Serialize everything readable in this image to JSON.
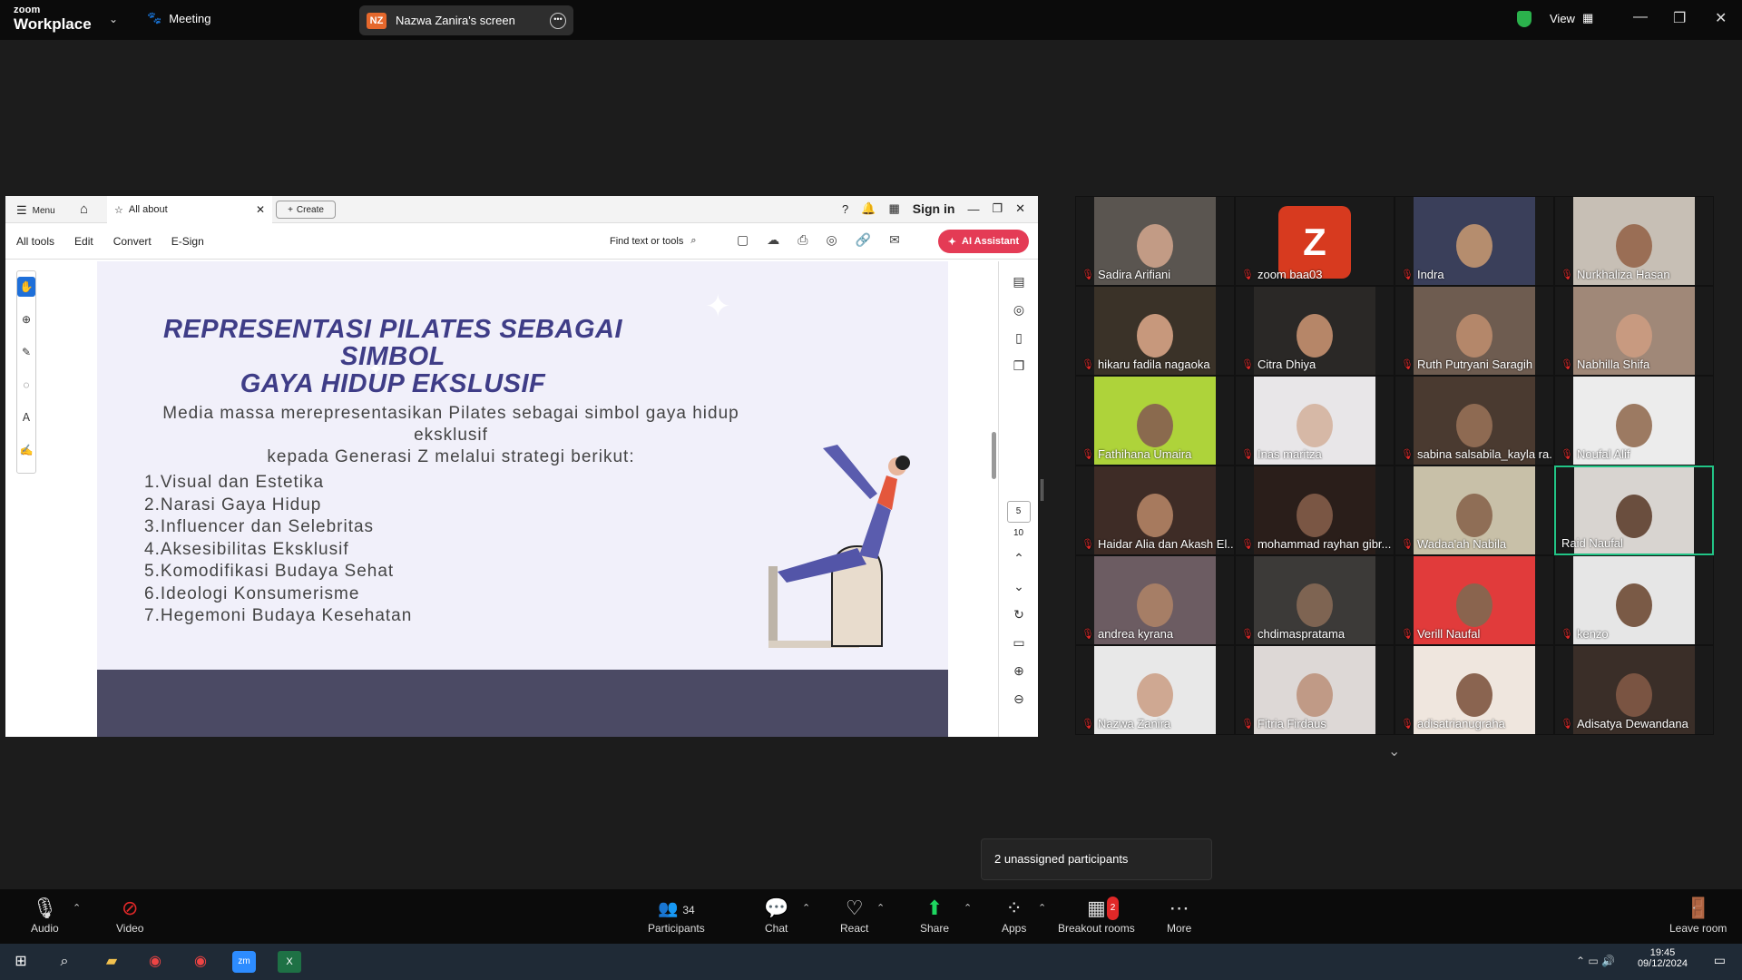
{
  "titlebar": {
    "logo_top": "zoom",
    "logo_bottom": "Workplace",
    "meeting_label": "Meeting",
    "share_initials": "NZ",
    "share_label": "Nazwa Zanira's screen",
    "view_label": "View"
  },
  "pdf": {
    "menu_label": "Menu",
    "tab_label": "All about",
    "create_label": "Create",
    "signin_label": "Sign in",
    "tools": [
      "All tools",
      "Edit",
      "Convert",
      "E-Sign"
    ],
    "find_label": "Find text or tools",
    "ai_label": "AI Assistant",
    "page_current": "5",
    "page_total": "10"
  },
  "slide": {
    "title_line1": "REPRESENTASI PILATES SEBAGAI SIMBOL",
    "title_line2": "GAYA HIDUP EKSLUSIF",
    "intro_line1": "Media massa merepresentasikan Pilates sebagai simbol gaya hidup eksklusif",
    "intro_line2": "kepada Generasi Z melalui strategi berikut:",
    "items": [
      "1.Visual dan Estetika",
      "2.Narasi Gaya Hidup",
      "3.Influencer dan Selebritas",
      "4.Aksesibilitas Eksklusif",
      "5.Komodifikasi Budaya Sehat",
      "6.Ideologi Konsumerisme",
      "7.Hegemoni Budaya Kesehatan"
    ]
  },
  "participants": [
    {
      "name": "Sadira Arifiani",
      "bg": "#5a5550",
      "face": "#c29b85"
    },
    {
      "name": "zoom baa03",
      "bg": "#1a1a1a",
      "avatar": "Z"
    },
    {
      "name": "Indra",
      "bg": "#3a3f5a",
      "face": "#b58d6e"
    },
    {
      "name": "Nurkhaliza Hasan",
      "bg": "#c7bfb5",
      "face": "#9a6e55"
    },
    {
      "name": "hikaru fadila nagaoka",
      "bg": "#3a3228",
      "face": "#c7987c"
    },
    {
      "name": "Citra Dhiya",
      "bg": "#2a2826",
      "face": "#b68668"
    },
    {
      "name": "Ruth Putryani Saragih",
      "bg": "#6e5c50",
      "face": "#b4876a"
    },
    {
      "name": "Nabhilla Shifa",
      "bg": "#a08878",
      "face": "#c89a80"
    },
    {
      "name": "Fathihana Umaira",
      "bg": "#aed33a",
      "face": "#8a6a4e"
    },
    {
      "name": "Inas maritza",
      "bg": "#e8e6e8",
      "face": "#d6b8a6"
    },
    {
      "name": "sabina salsabila_kayla ra...",
      "bg": "#4a3a30",
      "face": "#8e6a52"
    },
    {
      "name": "Noufal Alif",
      "bg": "#ececec",
      "face": "#9c7a62"
    },
    {
      "name": "Haidar Alia dan Akash El...",
      "bg": "#3e2c26",
      "face": "#a77a5e"
    },
    {
      "name": "mohammad rayhan gibr...",
      "bg": "#2a1e1a",
      "face": "#7a5644"
    },
    {
      "name": "Wadaa'ah Nabila",
      "bg": "#c8c0a8",
      "face": "#8f6e56"
    },
    {
      "name": "Raid Naufal",
      "bg": "#d8d4d0",
      "face": "#6a4e3e",
      "active": true
    },
    {
      "name": "andrea kyrana",
      "bg": "#6c5c62",
      "face": "#a67e66"
    },
    {
      "name": "chdimaspratama",
      "bg": "#3c3a38",
      "face": "#7e6452"
    },
    {
      "name": "Verill Naufal",
      "bg": "#e13b3b",
      "face": "#8a644e"
    },
    {
      "name": "kenzo",
      "bg": "#e6e6e6",
      "face": "#7a5a46"
    },
    {
      "name": "Nazwa Zanira",
      "bg": "#e8e8e8",
      "face": "#cfa892"
    },
    {
      "name": "Fitria Firdaus",
      "bg": "#ddd8d6",
      "face": "#c09a86"
    },
    {
      "name": "adisatrianugraha",
      "bg": "#efe6de",
      "face": "#8a6450"
    },
    {
      "name": "Adisatya Dewandana",
      "bg": "#3a2e28",
      "face": "#7a5442"
    }
  ],
  "popup": {
    "text": "2 unassigned participants"
  },
  "toolbar": {
    "audio": "Audio",
    "video": "Video",
    "participants": "Participants",
    "participants_count": "34",
    "chat": "Chat",
    "react": "React",
    "share": "Share",
    "apps": "Apps",
    "breakout": "Breakout rooms",
    "breakout_badge": "2",
    "more": "More",
    "leave": "Leave room"
  },
  "taskbar": {
    "time": "19:45",
    "date": "09/12/2024"
  }
}
